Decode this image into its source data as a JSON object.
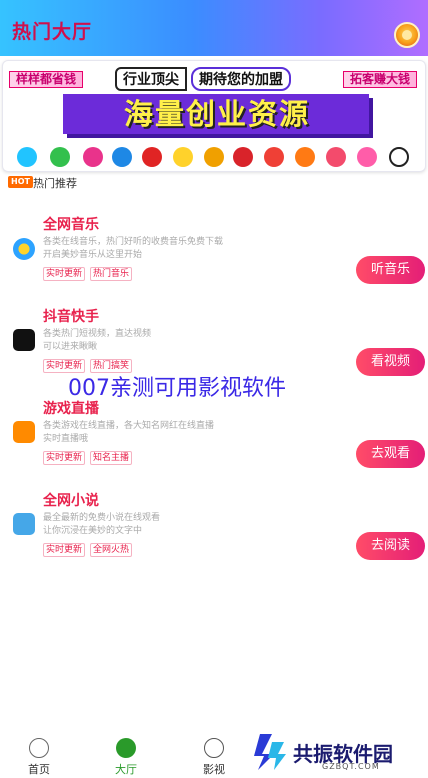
{
  "header": {
    "title": "热门大厅"
  },
  "banner": {
    "left_tag": "样样都省钱",
    "pill_a": "行业顶尖",
    "pill_b": "期待您的加盟",
    "right_tag": "拓客赚大钱",
    "headline": "海量创业资源"
  },
  "section": {
    "hot_badge": "HOT",
    "title": "热门推荐"
  },
  "items": [
    {
      "title": "全网音乐",
      "desc_1": "各类在线音乐，热门好听的收费音乐免费下载",
      "desc_2": "开启美妙音乐从这里开始",
      "tag_1": "实时更新",
      "tag_2": "热门音乐",
      "button": "听音乐",
      "icon": "music-icon"
    },
    {
      "title": "抖音快手",
      "desc_1": "各类热门短视频，直达视频",
      "desc_2": "可以进来瞅瞅",
      "tag_1": "实时更新",
      "tag_2": "热门搞笑",
      "button": "看视频",
      "icon": "tiktok-icon"
    },
    {
      "title": "游戏直播",
      "desc_1": "各类游戏在线直播，各大知名网红在线直播",
      "desc_2": "实时直播哦",
      "tag_1": "实时更新",
      "tag_2": "知名主播",
      "button": "去观看",
      "icon": "game-live-icon"
    },
    {
      "title": "全网小说",
      "desc_1": "最全最新的免费小说在线观看",
      "desc_2": "让你沉浸在美妙的文字中",
      "tag_1": "实时更新",
      "tag_2": "全网火热",
      "button": "去阅读",
      "icon": "novel-icon"
    }
  ],
  "overlay": "007亲测可用影视软件",
  "nav": [
    {
      "label": "首页",
      "icon": "play-circle-icon"
    },
    {
      "label": "大厅",
      "icon": "compass-icon"
    },
    {
      "label": "影视",
      "icon": "film-star-icon"
    }
  ],
  "watermark": {
    "name": "共振软件园",
    "domain": "GZBQT.COM"
  },
  "colors": {
    "accent": "#e8224d",
    "button_start": "#ff4c68",
    "button_end": "#e41e77",
    "nav_active": "#2a9a2a"
  }
}
